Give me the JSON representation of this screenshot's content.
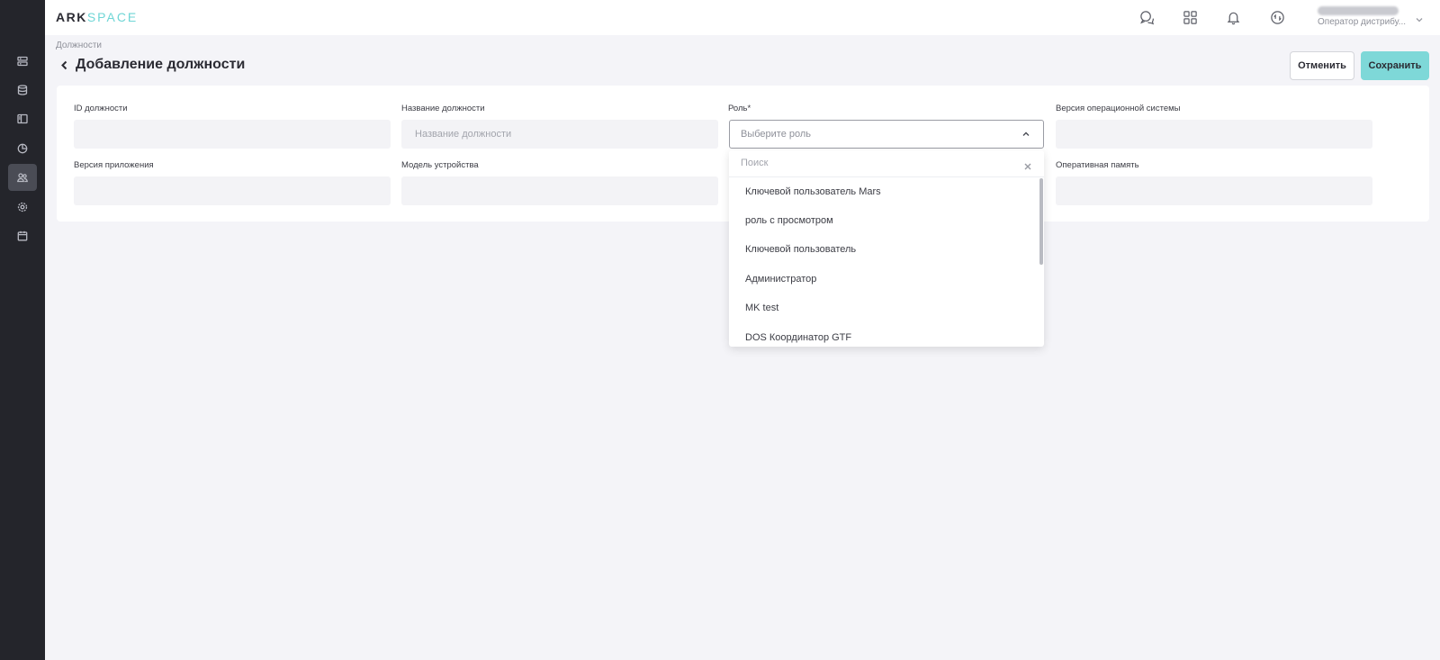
{
  "app": {
    "logo_part1": "ARK",
    "logo_part2": "SPACE"
  },
  "sidebar": {
    "items": [
      {
        "icon": "list-icon",
        "active": false
      },
      {
        "icon": "database-icon",
        "active": false
      },
      {
        "icon": "layout-icon",
        "active": false
      },
      {
        "icon": "pie-chart-icon",
        "active": false
      },
      {
        "icon": "users-icon",
        "active": true
      },
      {
        "icon": "gear-icon",
        "active": false
      },
      {
        "icon": "calendar-icon",
        "active": false
      }
    ]
  },
  "topbar": {
    "icons": [
      "chat-icon",
      "apps-grid-icon",
      "bell-icon",
      "sync-icon"
    ],
    "user_role": "Оператор дистрибу..."
  },
  "breadcrumb": "Должности",
  "page_title": "Добавление должности",
  "actions": {
    "cancel": "Отменить",
    "save": "Сохранить"
  },
  "form": {
    "id_label": "ID должности",
    "id_value": "",
    "name_label": "Название должности",
    "name_placeholder": "Название должности",
    "role_label": "Роль*",
    "role_placeholder": "Выберите роль",
    "os_label": "Версия операционной системы",
    "os_value": "",
    "app_label": "Версия приложения",
    "app_value": "",
    "device_label": "Модель устройства",
    "device_value": "",
    "ram_label": "Оперативная память",
    "ram_value": ""
  },
  "role_dropdown": {
    "search_placeholder": "Поиск",
    "options": [
      "Ключевой пользователь Mars",
      "роль с просмотром",
      "Ключевой пользователь",
      "Администратор",
      "MK test",
      "DOS Координатор GTF"
    ]
  },
  "colors": {
    "accent": "#7ed8d8",
    "sidebar_bg": "#24252b",
    "page_bg": "#f4f4f8"
  }
}
